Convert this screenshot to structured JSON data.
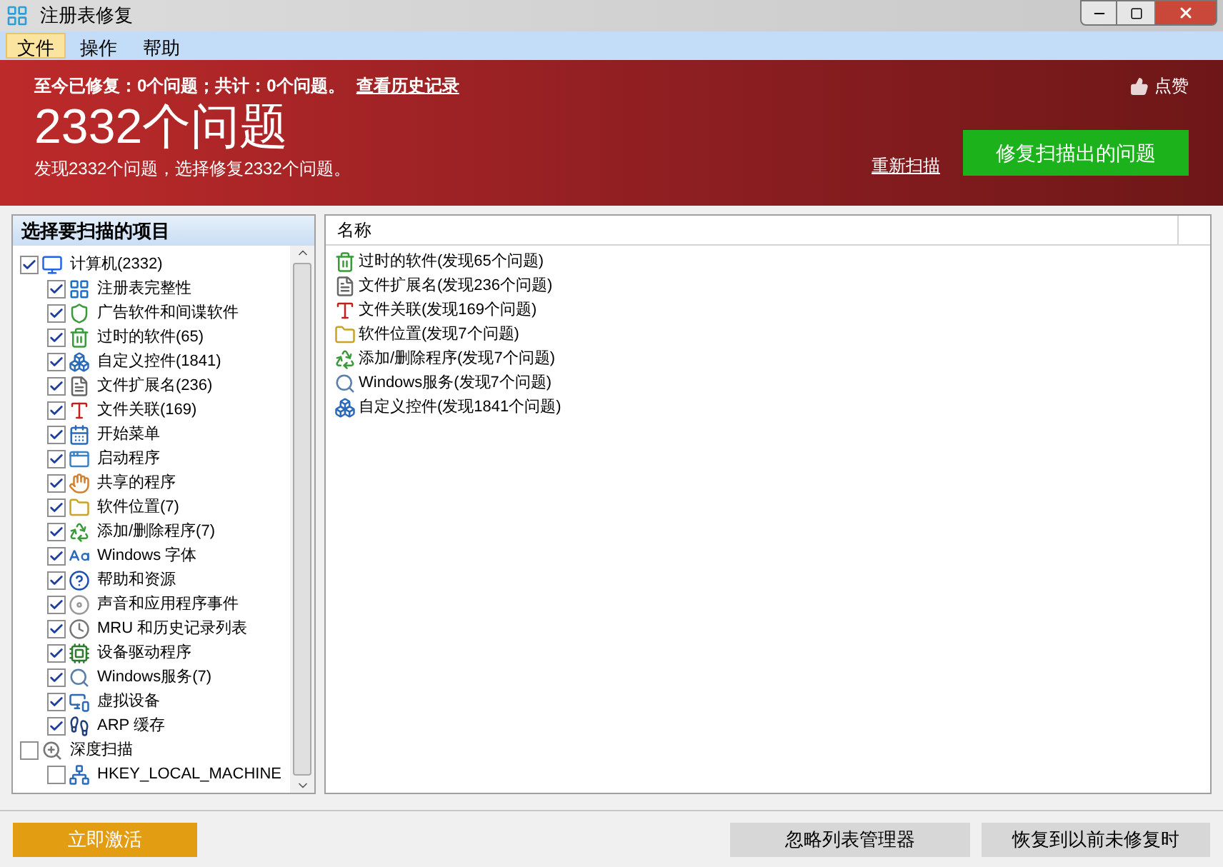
{
  "window": {
    "title": "注册表修复"
  },
  "menu": [
    {
      "label": "文件",
      "selected": true
    },
    {
      "label": "操作",
      "selected": false
    },
    {
      "label": "帮助",
      "selected": false
    }
  ],
  "banner": {
    "summary": "至今已修复：0个问题；共计：0个问题。",
    "history_link": "查看历史记录",
    "like": "点赞",
    "headline": "2332个问题",
    "subline": "发现2332个问题，选择修复2332个问题。",
    "rescan_link": "重新扫描",
    "fix_button": "修复扫描出的问题"
  },
  "tree": {
    "title": "选择要扫描的项目",
    "items": [
      {
        "label": "计算机(2332)",
        "checked": true,
        "kind": "computer",
        "children": [
          {
            "label": "注册表完整性",
            "checked": true,
            "kind": "grid"
          },
          {
            "label": "广告软件和间谍软件",
            "checked": true,
            "kind": "shield"
          },
          {
            "label": "过时的软件(65)",
            "checked": true,
            "kind": "trash"
          },
          {
            "label": "自定义控件(1841)",
            "checked": true,
            "kind": "blocks"
          },
          {
            "label": "文件扩展名(236)",
            "checked": true,
            "kind": "file"
          },
          {
            "label": "文件关联(169)",
            "checked": true,
            "kind": "letter"
          },
          {
            "label": "开始菜单",
            "checked": true,
            "kind": "calendar"
          },
          {
            "label": "启动程序",
            "checked": true,
            "kind": "window"
          },
          {
            "label": "共享的程序",
            "checked": true,
            "kind": "hand"
          },
          {
            "label": "软件位置(7)",
            "checked": true,
            "kind": "folder"
          },
          {
            "label": "添加/删除程序(7)",
            "checked": true,
            "kind": "recycle"
          },
          {
            "label": "Windows 字体",
            "checked": true,
            "kind": "font"
          },
          {
            "label": "帮助和资源",
            "checked": true,
            "kind": "help"
          },
          {
            "label": "声音和应用程序事件",
            "checked": true,
            "kind": "disc"
          },
          {
            "label": "MRU 和历史记录列表",
            "checked": true,
            "kind": "clock"
          },
          {
            "label": "设备驱动程序",
            "checked": true,
            "kind": "chip"
          },
          {
            "label": "Windows服务(7)",
            "checked": true,
            "kind": "search"
          },
          {
            "label": "虚拟设备",
            "checked": true,
            "kind": "monitor"
          },
          {
            "label": "ARP 缓存",
            "checked": true,
            "kind": "footprints"
          }
        ]
      },
      {
        "label": "深度扫描",
        "checked": false,
        "kind": "zoom",
        "children": [
          {
            "label": "HKEY_LOCAL_MACHINE",
            "checked": false,
            "kind": "network"
          }
        ]
      }
    ]
  },
  "results": {
    "columns": [
      "名称"
    ],
    "rows": [
      {
        "label": "过时的软件(发现65个问题)",
        "kind": "trash"
      },
      {
        "label": "文件扩展名(发现236个问题)",
        "kind": "file"
      },
      {
        "label": "文件关联(发现169个问题)",
        "kind": "letter"
      },
      {
        "label": "软件位置(发现7个问题)",
        "kind": "folder"
      },
      {
        "label": "添加/删除程序(发现7个问题)",
        "kind": "recycle"
      },
      {
        "label": "Windows服务(发现7个问题)",
        "kind": "search"
      },
      {
        "label": "自定义控件(发现1841个问题)",
        "kind": "blocks"
      }
    ]
  },
  "footer": {
    "activate_button": "立即激活",
    "ignore_button": "忽略列表管理器",
    "restore_button": "恢复到以前未修复时"
  }
}
